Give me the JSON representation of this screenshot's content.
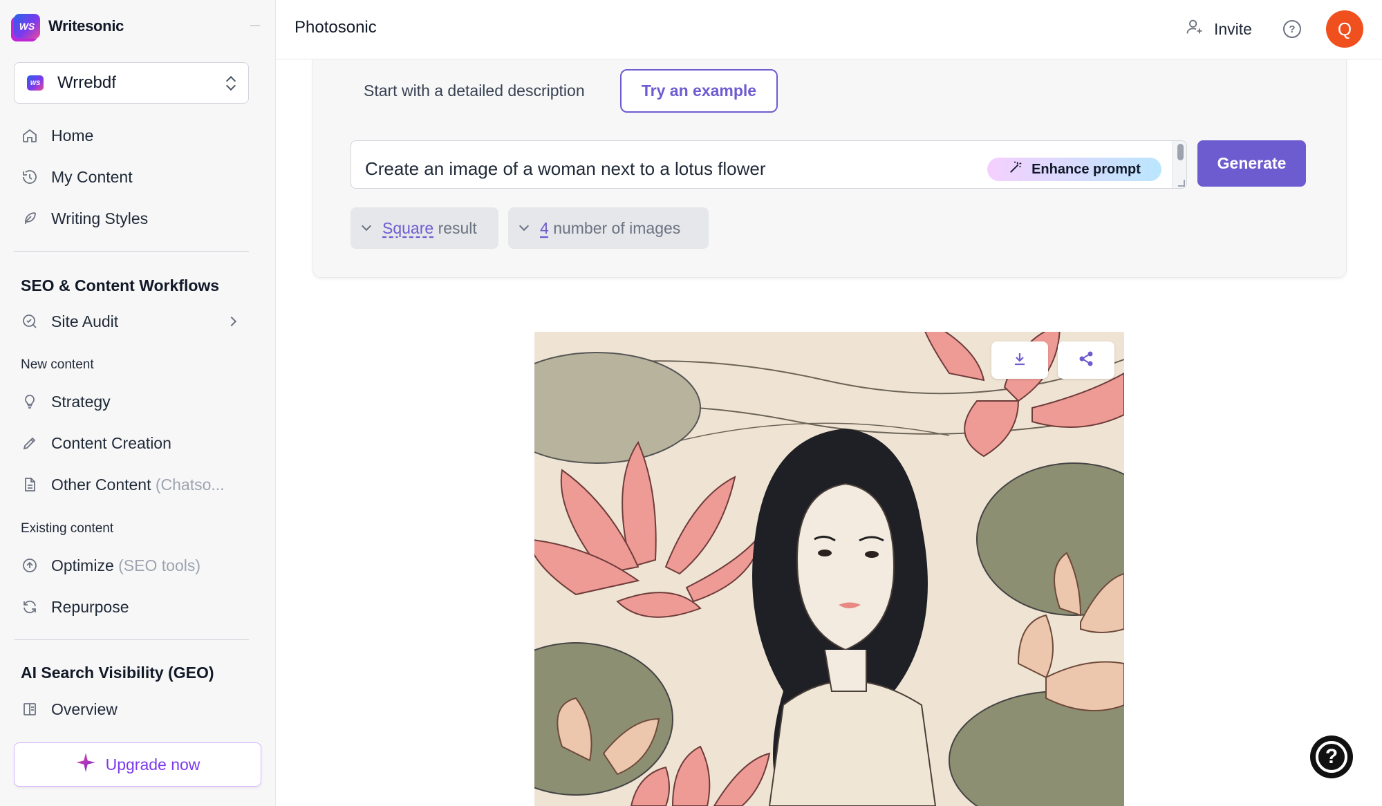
{
  "brand": {
    "name": "Writesonic",
    "logo_text": "WS"
  },
  "workspace": {
    "name": "Wrrebdf"
  },
  "nav": {
    "home": "Home",
    "my_content": "My Content",
    "writing_styles": "Writing Styles",
    "seo_section": "SEO & Content Workflows",
    "site_audit": "Site Audit",
    "new_content": "New content",
    "strategy": "Strategy",
    "content_creation": "Content Creation",
    "other_content": "Other Content",
    "other_content_note": "(Chatso...",
    "existing_content": "Existing content",
    "optimize": "Optimize",
    "optimize_note": "(SEO tools)",
    "repurpose": "Repurpose",
    "geo_section": "AI Search Visibility (GEO)",
    "overview": "Overview",
    "upgrade": "Upgrade now"
  },
  "header": {
    "title": "Photosonic",
    "invite": "Invite",
    "avatar_initial": "Q"
  },
  "generator": {
    "start_label": "Start with a detailed description",
    "try_example": "Try an example",
    "prompt_value": "Create an image of a woman next to a lotus flower",
    "enhance_prompt": "Enhance prompt",
    "generate": "Generate",
    "aspect_value": "Square",
    "aspect_suffix": "result",
    "count_value": "4",
    "count_suffix": "number of images"
  },
  "colors": {
    "accent": "#6d5bd0",
    "avatar": "#f0501e",
    "upgrade_text": "#7c3aed"
  },
  "icons": [
    "home-icon",
    "history-icon",
    "feather-icon",
    "audit-icon",
    "lightbulb-icon",
    "pencil-icon",
    "document-icon",
    "arrow-up-circle-icon",
    "refresh-icon",
    "book-icon",
    "sparkle-icon",
    "add-user-icon",
    "help-icon",
    "wand-icon",
    "download-icon",
    "share-icon"
  ]
}
